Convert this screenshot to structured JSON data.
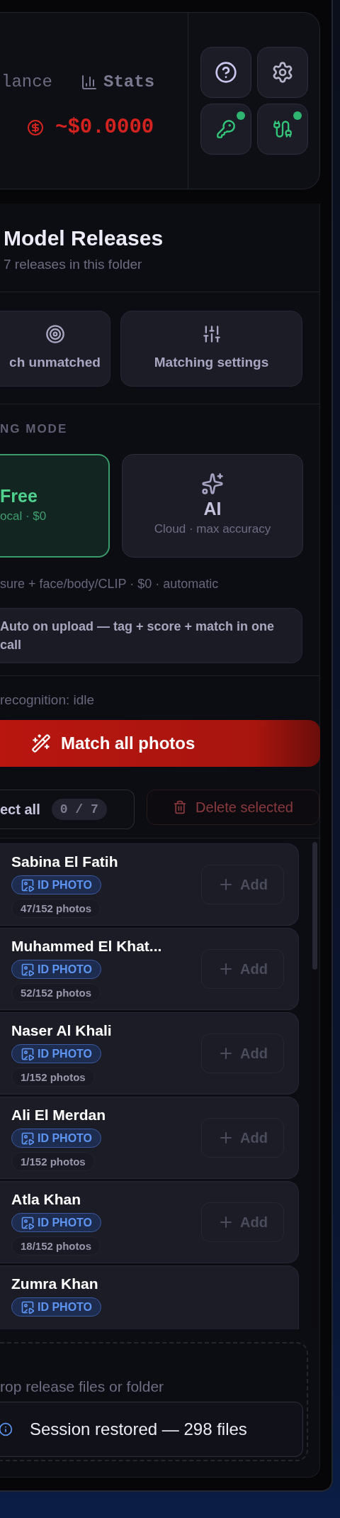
{
  "header": {
    "balance_label": "lance",
    "stats_label": "Stats",
    "cost": "~$0.0000",
    "buttons": [
      {
        "kind": "help",
        "connected": false
      },
      {
        "kind": "settings",
        "connected": false
      },
      {
        "kind": "key",
        "connected": true
      },
      {
        "kind": "plug",
        "connected": true
      }
    ]
  },
  "releases": {
    "title": "Model Releases",
    "subtitle": "7 releases in this folder"
  },
  "actions": [
    {
      "kind": "target",
      "label": "ch unmatched"
    },
    {
      "kind": "sliders",
      "label": "Matching settings"
    }
  ],
  "mode": {
    "heading": "NG MODE",
    "options": [
      {
        "kind": "free",
        "title": "Free",
        "subtitle": "ocal · $0",
        "selected": true
      },
      {
        "kind": "ai",
        "title": "AI",
        "subtitle": "Cloud · max accuracy",
        "selected": false
      }
    ],
    "description": "sure + face/body/CLIP · $0 · automatic"
  },
  "auto_option": {
    "label": "Auto on upload — tag + score + match in one call"
  },
  "recognition_status": "recognition: idle",
  "match_button": "Match all photos",
  "selection": {
    "select_label": "ect all",
    "count": "0 / 7",
    "delete_label": "Delete selected",
    "delete_disabled": true
  },
  "models": [
    {
      "name": "Sabina El Fatih",
      "badge": "ID PHOTO",
      "count": "47/152 photos",
      "add": "Add"
    },
    {
      "name": "Muhammed El Khat...",
      "badge": "ID PHOTO",
      "count": "52/152 photos",
      "add": "Add"
    },
    {
      "name": "Naser Al Khali",
      "badge": "ID PHOTO",
      "count": "1/152 photos",
      "add": "Add"
    },
    {
      "name": "Ali El Merdan",
      "badge": "ID PHOTO",
      "count": "1/152 photos",
      "add": "Add"
    },
    {
      "name": "Atla Khan",
      "badge": "ID PHOTO",
      "count": "18/152 photos",
      "add": "Add"
    },
    {
      "name": "Zumra Khan",
      "badge": "ID PHOTO"
    }
  ],
  "drop_zone": "rop release files or folder",
  "toast": "Session restored — 298 files"
}
